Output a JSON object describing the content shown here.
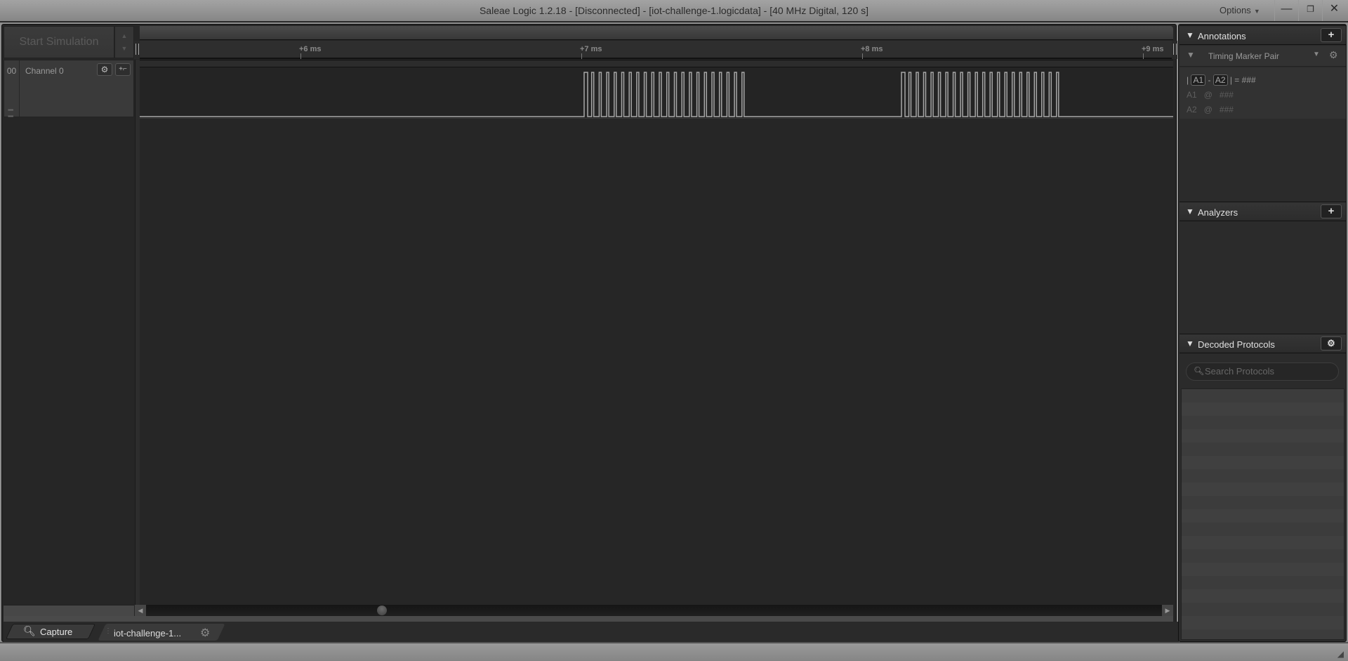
{
  "window": {
    "title": "Saleae Logic 1.2.18 - [Disconnected] - [iot-challenge-1.logicdata] - [40 MHz Digital, 120 s]",
    "options_label": "Options",
    "minimize_icon": "minimize-icon",
    "restore_icon": "restore-icon",
    "close_icon": "close-icon"
  },
  "toolbar": {
    "start_simulation_label": "Start Simulation"
  },
  "timeline": {
    "ticks": [
      "+6 ms",
      "+7 ms",
      "+8 ms",
      "+9 ms"
    ],
    "tick_times_ms": [
      6,
      7,
      8,
      9
    ],
    "visible_start_ms": 5.0,
    "visible_end_ms": 9.1
  },
  "channels": [
    {
      "number": "00",
      "name": "Channel 0",
      "settings_icon": "gear-icon",
      "trigger_icon": "rising-edge-trigger-icon",
      "signal": {
        "idle_level": "low",
        "pulse_bursts": [
          {
            "start_ms": 7.01,
            "end_ms": 7.58,
            "pulse_count": 22
          },
          {
            "start_ms": 8.14,
            "end_ms": 8.7,
            "pulse_count": 22
          }
        ]
      }
    }
  ],
  "bottom_tabs": {
    "capture_label": "Capture",
    "file_tab_label": "iot-challenge-1...",
    "file_tab_icon": "gear-icon"
  },
  "annotations": {
    "title": "Annotations",
    "add_icon": "plus-icon",
    "marker_type": "Timing Marker Pair",
    "formula_a1": "A1",
    "formula_a2": "A2",
    "formula_value": "###",
    "a1_label": "A1",
    "a1_at": "@",
    "a1_value": "###",
    "a2_label": "A2",
    "a2_at": "@",
    "a2_value": "###"
  },
  "analyzers": {
    "title": "Analyzers",
    "add_icon": "plus-icon"
  },
  "decoded_protocols": {
    "title": "Decoded Protocols",
    "settings_icon": "gear-icon",
    "search_placeholder": "Search Protocols"
  },
  "colors": {
    "background": "#262626",
    "waveform": "#a6a6a6",
    "titlebar": "#969696"
  }
}
